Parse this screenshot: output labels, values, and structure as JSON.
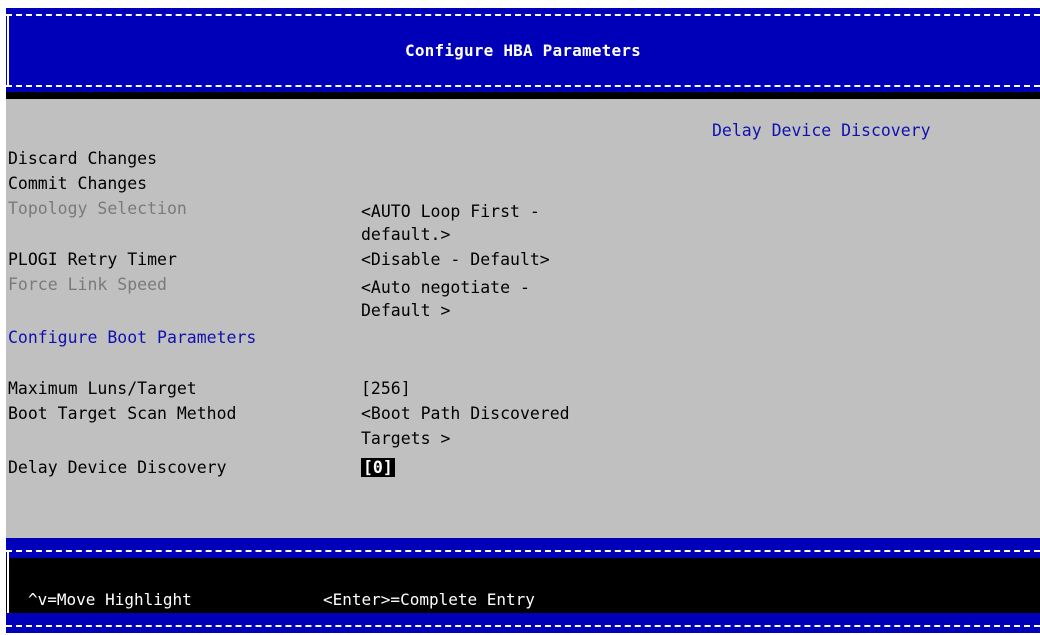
{
  "header": {
    "title": "Configure HBA Parameters"
  },
  "help": {
    "text": "Delay Device Discovery"
  },
  "actions": [
    {
      "label": "Discard Changes"
    },
    {
      "label": "Commit  Changes"
    }
  ],
  "settings": [
    {
      "label": "Topology Selection",
      "value_line1": "<AUTO Loop First -",
      "value_line2": "default.>"
    },
    {
      "label": "PLOGI Retry Timer",
      "value_line1": "<Disable - Default>"
    },
    {
      "label": "Force Link Speed",
      "value_line1": "<Auto negotiate -",
      "value_line2": "Default >"
    }
  ],
  "section": {
    "label": "Configure Boot Parameters"
  },
  "boot_settings": [
    {
      "label": "Maximum Luns/Target",
      "value_line1": "[256]"
    },
    {
      "label": "Boot Target Scan Method",
      "value_line1": "<Boot Path Discovered",
      "value_line2": "Targets  >"
    },
    {
      "label": "Delay Device Discovery",
      "value_line1": "[0]"
    }
  ],
  "footer": {
    "hint1": "^v=Move Highlight",
    "hint2": "<Enter>=Complete Entry"
  },
  "colors": {
    "frame_blue": "#0000b8",
    "panel_grey": "#c0c0c0",
    "help_text": "#1010b0",
    "disabled_text": "#7a7a7a"
  }
}
